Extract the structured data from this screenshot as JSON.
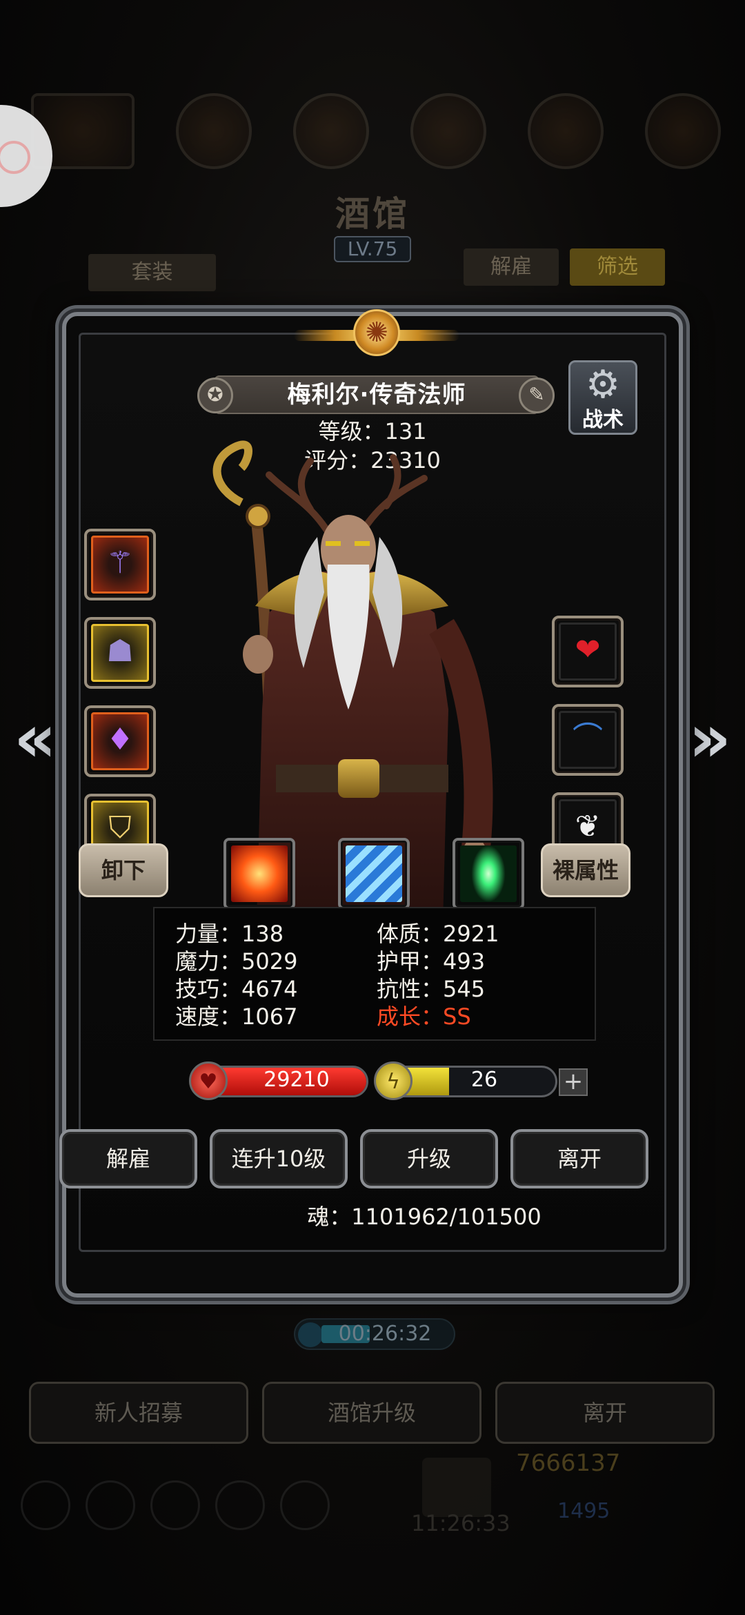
{
  "background": {
    "title": "酒馆",
    "level": "LV.75",
    "suit_label": "套装",
    "dismiss_label": "解雇",
    "filter_label": "筛选",
    "timer": "00:26:32",
    "bottom_buttons": [
      "新人招募",
      "酒馆升级",
      "离开"
    ],
    "gold": "7666137",
    "gems": "1495",
    "clock": "11:26:33"
  },
  "hero": {
    "name": "梅利尔·传奇法师",
    "level_line": "等级：131",
    "score_line": "评分：23310",
    "tactic_label": "战术",
    "unequip_label": "卸下",
    "naked_attr_label": "裸属性",
    "equipment_left": [
      {
        "icon": "staff-icon",
        "frame": "red"
      },
      {
        "icon": "robe-icon",
        "frame": "gold"
      },
      {
        "icon": "amulet-icon",
        "frame": "red"
      },
      {
        "icon": "shield-icon",
        "frame": "gold"
      }
    ],
    "equipment_right": [
      {
        "icon": "heart-charm-icon"
      },
      {
        "icon": "blue-arc-icon"
      },
      {
        "icon": "wing-icon"
      }
    ],
    "skills": [
      {
        "icon": "fire-burst-icon",
        "color": "#ff5a14"
      },
      {
        "icon": "ice-storm-icon",
        "color": "#3aa8ff"
      },
      {
        "icon": "green-crystal-icon",
        "color": "#3cf07a"
      }
    ],
    "stats": {
      "strength": "力量：138",
      "magic": "魔力：5029",
      "skill": "技巧：4674",
      "speed": "速度：1067",
      "constitution": "体质：2921",
      "armor": "护甲：493",
      "resistance": "抗性：545",
      "growth": "成长：SS"
    },
    "hp": "29210",
    "hp_fill": 1.0,
    "energy": "26",
    "energy_fill": 0.36,
    "actions": [
      "解雇",
      "连升10级",
      "升级",
      "离开"
    ],
    "soul": "魂：1101962/101500"
  },
  "colors": {
    "growth": "#ff4a24",
    "hp": "#e0201a",
    "energy": "#e0c828"
  }
}
